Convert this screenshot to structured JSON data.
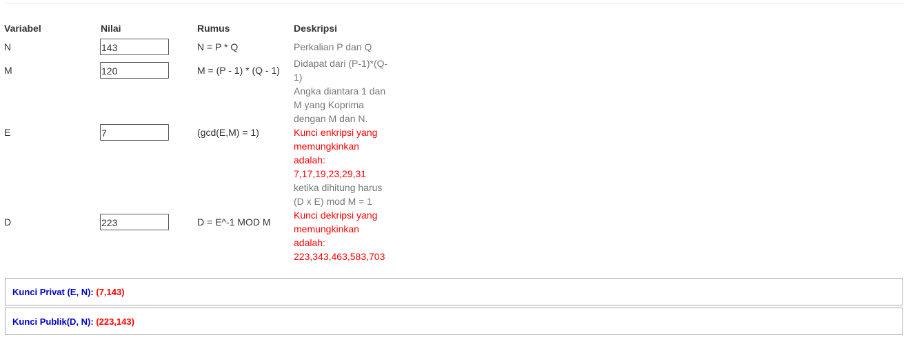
{
  "table": {
    "headers": {
      "variable": "Variabel",
      "value": "Nilai",
      "formula": "Rumus",
      "description": "Deskripsi"
    },
    "rows": {
      "n": {
        "variable": "N",
        "value": "143",
        "formula": "N = P * Q",
        "desc_gray": "Perkalian P dan Q"
      },
      "m": {
        "variable": "M",
        "value": "120",
        "formula": "M = (P - 1) * (Q - 1)",
        "desc_gray": "Didapat dari (P-1)*(Q-1)"
      },
      "e": {
        "variable": "E",
        "value": "7",
        "formula": "(gcd(E,M) = 1)",
        "desc_gray": "Angka diantara 1 dan M yang Koprima dengan M dan N.",
        "desc_red": "Kunci enkripsi yang memungkinkan adalah: 7,17,19,23,29,31"
      },
      "d": {
        "variable": "D",
        "value": "223",
        "formula": "D = E^-1 MOD M",
        "desc_gray": "ketika dihitung harus (D x E) mod M = 1",
        "desc_red": "Kunci dekripsi yang memungkinkan adalah: 223,343,463,583,703"
      }
    }
  },
  "keys": {
    "private": {
      "label": "Kunci Privat (E, N):",
      "value": "(7,143)"
    },
    "public": {
      "label": "Kunci Publik(D, N):",
      "value": "(223,143)"
    }
  },
  "colors": {
    "key_label": "#0000cc",
    "highlight_red": "#ff0000",
    "desc_gray": "#777777"
  }
}
